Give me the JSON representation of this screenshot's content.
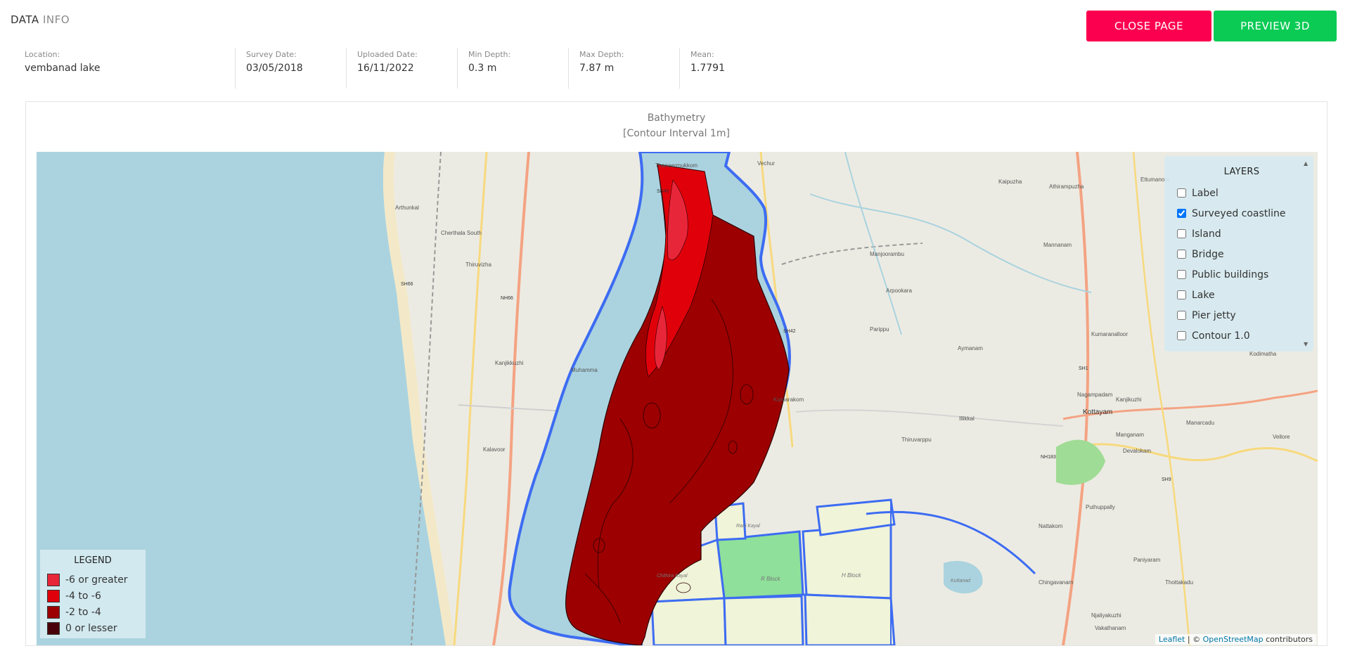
{
  "header": {
    "title_strong": "DATA",
    "title_light": "INFO"
  },
  "actions": {
    "close_label": "CLOSE PAGE",
    "preview_label": "PREVIEW 3D"
  },
  "info": [
    {
      "label": "Location:",
      "value": "vembanad lake"
    },
    {
      "label": "Survey Date:",
      "value": "03/05/2018"
    },
    {
      "label": "Uploaded Date:",
      "value": "16/11/2022"
    },
    {
      "label": "Min Depth:",
      "value": "0.3 m"
    },
    {
      "label": "Max Depth:",
      "value": "7.87 m"
    },
    {
      "label": "Mean:",
      "value": "1.7791"
    }
  ],
  "panel": {
    "title": "Bathymetry",
    "subtitle": "[Contour Interval 1m]"
  },
  "layers": {
    "title": "LAYERS",
    "items": [
      {
        "label": "Label",
        "checked": false
      },
      {
        "label": "Surveyed coastline",
        "checked": true
      },
      {
        "label": "Island",
        "checked": false
      },
      {
        "label": "Bridge",
        "checked": false
      },
      {
        "label": "Public buildings",
        "checked": false
      },
      {
        "label": "Lake",
        "checked": false
      },
      {
        "label": "Pier jetty",
        "checked": false
      },
      {
        "label": "Contour 1.0",
        "checked": false
      }
    ]
  },
  "legend": {
    "title": "LEGEND",
    "items": [
      {
        "label": "-6 or greater",
        "color": "#e8263a"
      },
      {
        "label": "-4 to -6",
        "color": "#e0000a"
      },
      {
        "label": "-2 to -4",
        "color": "#9c0000"
      },
      {
        "label": "0 or lesser",
        "color": "#4a0008"
      }
    ]
  },
  "map_labels": [
    "Thaneermukkom",
    "Vechur",
    "Kaipuzha",
    "Athirampuzha",
    "Ettumanoor",
    "Arthunkal",
    "Cherthala South",
    "Thiruvizha",
    "Manjoorambu",
    "Mannanam",
    "Arpookara",
    "Parippu",
    "Aymanam",
    "Kumaranalloor",
    "Muhamma",
    "Kanjikkuzhi",
    "Kumarakom",
    "Illikkal",
    "Nagampadam",
    "Kottayam",
    "Manarcadu",
    "Kanjikuzhi",
    "Devalokam",
    "Thiruvarppu",
    "Kalavoor",
    "Puthuppally",
    "Nattakom",
    "Chingavanam",
    "Paniyaram",
    "Vakathanam",
    "Njaliyakuzhi",
    "Thottakadu",
    "Vellore",
    "Manganam",
    "Kodimatha",
    "R Block",
    "H Block",
    "Rani Kayal",
    "Chithira Kayal",
    "Kuttanad"
  ],
  "road_labels": [
    "SH40",
    "SH66",
    "NH66",
    "SH42",
    "SH1",
    "NH183",
    "SH9"
  ],
  "attribution": {
    "leaflet": "Leaflet",
    "separator": " | © ",
    "osm": "OpenStreetMap",
    "suffix": " contributors"
  },
  "colors": {
    "sea": "#aad3df",
    "land": "#eeece4",
    "boundary": "#3d6cf2",
    "close_button": "#fc0050",
    "preview_button": "#0bcb55"
  }
}
